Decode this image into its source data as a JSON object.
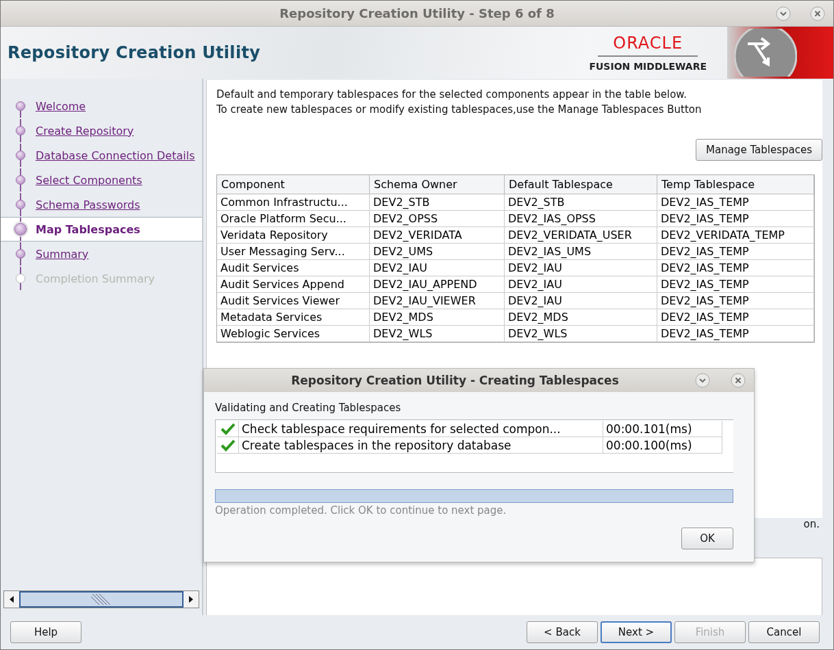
{
  "window": {
    "title": "Repository Creation Utility - Step 6 of 8"
  },
  "header": {
    "title": "Repository Creation Utility",
    "logo_brand": "ORACLE",
    "logo_product": "FUSION MIDDLEWARE"
  },
  "steps": [
    {
      "label": "Welcome",
      "selected": false,
      "disabled": false
    },
    {
      "label": "Create Repository",
      "selected": false,
      "disabled": false
    },
    {
      "label": "Database Connection Details",
      "selected": false,
      "disabled": false
    },
    {
      "label": "Select Components",
      "selected": false,
      "disabled": false
    },
    {
      "label": "Schema Passwords",
      "selected": false,
      "disabled": false
    },
    {
      "label": "Map Tablespaces",
      "selected": true,
      "disabled": false
    },
    {
      "label": "Summary",
      "selected": false,
      "disabled": false
    },
    {
      "label": "Completion Summary",
      "selected": false,
      "disabled": true
    }
  ],
  "content": {
    "description": [
      "Default and temporary tablespaces for the selected components appear in the table below.",
      "To create new tablespaces or modify existing tablespaces,use the Manage Tablespaces Button"
    ],
    "manage_button": "Manage Tablespaces",
    "table": {
      "columns": [
        "Component",
        "Schema Owner",
        "Default Tablespace",
        "Temp Tablespace"
      ],
      "rows": [
        [
          "Common Infrastructu...",
          "DEV2_STB",
          "DEV2_STB",
          "DEV2_IAS_TEMP"
        ],
        [
          "Oracle Platform Secu...",
          "DEV2_OPSS",
          "DEV2_IAS_OPSS",
          "DEV2_IAS_TEMP"
        ],
        [
          "Veridata Repository",
          "DEV2_VERIDATA",
          "DEV2_VERIDATA_USER",
          "DEV2_VERIDATA_TEMP"
        ],
        [
          "User Messaging Serv...",
          "DEV2_UMS",
          "DEV2_IAS_UMS",
          "DEV2_IAS_TEMP"
        ],
        [
          "Audit Services",
          "DEV2_IAU",
          "DEV2_IAU",
          "DEV2_IAS_TEMP"
        ],
        [
          "Audit Services Append",
          "DEV2_IAU_APPEND",
          "DEV2_IAU",
          "DEV2_IAS_TEMP"
        ],
        [
          "Audit Services Viewer",
          "DEV2_IAU_VIEWER",
          "DEV2_IAU",
          "DEV2_IAS_TEMP"
        ],
        [
          "Metadata Services",
          "DEV2_MDS",
          "DEV2_MDS",
          "DEV2_IAS_TEMP"
        ],
        [
          "Weblogic Services",
          "DEV2_WLS",
          "DEV2_WLS",
          "DEV2_IAS_TEMP"
        ]
      ]
    },
    "partial_text": "on."
  },
  "dialog": {
    "title": "Repository Creation Utility - Creating Tablespaces",
    "heading": "Validating and Creating Tablespaces",
    "tasks": [
      {
        "name": "Check tablespace requirements for selected compon...",
        "time": "00:00.101(ms)",
        "done": true
      },
      {
        "name": "Create tablespaces in the repository database",
        "time": "00:00.100(ms)",
        "done": true
      }
    ],
    "progress": {
      "level": 1
    },
    "status": "Operation completed. Click OK to continue to next page.",
    "ok_button": "OK"
  },
  "buttons": [
    {
      "label": "Help",
      "disabled": false,
      "selected": false
    },
    {
      "label": "< Back",
      "disabled": false,
      "selected": false
    },
    {
      "label": "Next >",
      "disabled": false,
      "selected": true
    },
    {
      "label": "Finish",
      "disabled": true,
      "selected": false
    },
    {
      "label": "Cancel",
      "disabled": false,
      "selected": false
    }
  ]
}
